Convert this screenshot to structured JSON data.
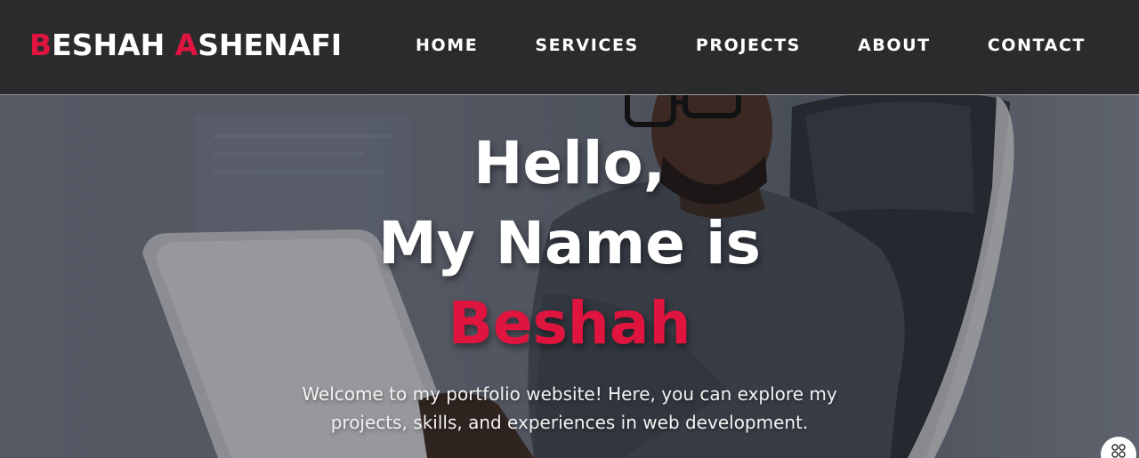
{
  "header": {
    "logo": {
      "first_initial": "B",
      "first_rest": "ESHAH ",
      "last_initial": "A",
      "last_rest": "SHENAFI"
    },
    "nav": [
      {
        "label": "HOME"
      },
      {
        "label": "SERVICES"
      },
      {
        "label": "PROJECTS"
      },
      {
        "label": "ABOUT"
      },
      {
        "label": "CONTACT"
      }
    ]
  },
  "hero": {
    "greeting": "Hello,",
    "name_intro": "My Name is",
    "name": "Beshah",
    "welcome_line1": "Welcome to my portfolio website! Here, you can explore my",
    "welcome_line2": "projects, skills, and experiences in web development."
  },
  "colors": {
    "accent": "#e0153f",
    "header_bg": "#2b2b2d",
    "text": "#ffffff"
  },
  "icons": {
    "floating_button": "apps-icon"
  }
}
